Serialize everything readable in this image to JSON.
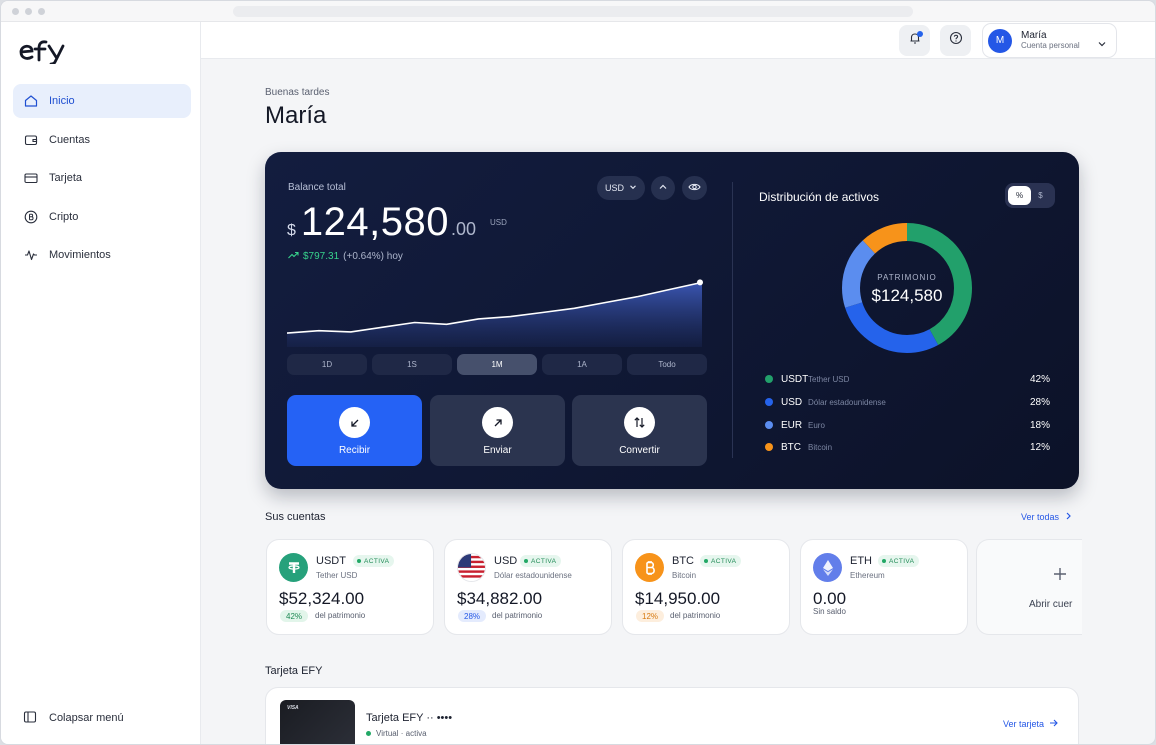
{
  "brand": {
    "logo_text": "efy"
  },
  "sidebar": {
    "items": [
      {
        "label": "Inicio",
        "icon": "home-icon"
      },
      {
        "label": "Cuentas",
        "icon": "wallet-icon"
      },
      {
        "label": "Tarjeta",
        "icon": "credit-card-icon"
      },
      {
        "label": "Cripto",
        "icon": "bitcoin-icon"
      },
      {
        "label": "Movimientos",
        "icon": "activity-icon"
      }
    ],
    "collapse_label": "Colapsar menú"
  },
  "topbar": {
    "user": {
      "initial": "M",
      "name": "María",
      "subtitle": "Cuenta personal"
    }
  },
  "greeting": {
    "line": "Buenas tardes",
    "name": "María"
  },
  "balance": {
    "label": "Balance total",
    "currency_symbol": "$",
    "integer": "124,580",
    "decimals": ".00",
    "unit": "USD",
    "change_amount": "$797.31",
    "change_rest": "(+0.64%) hoy",
    "currency_select": "USD",
    "ranges": [
      "1D",
      "1S",
      "1M",
      "1A",
      "Todo"
    ],
    "active_range": "1M",
    "actions": [
      "Recibir",
      "Enviar",
      "Convertir"
    ]
  },
  "distribution": {
    "title": "Distribución de activos",
    "toggle": [
      "%",
      "$"
    ],
    "center_label": "PATRIMONIO",
    "center_value": "$124,580",
    "assets": [
      {
        "sym": "USDT",
        "desc": "Tether USD",
        "pct": "42%",
        "value": 42,
        "color": "#22a06b"
      },
      {
        "sym": "USD",
        "desc": "Dólar estadounidense",
        "pct": "28%",
        "value": 28,
        "color": "#2563eb"
      },
      {
        "sym": "EUR",
        "desc": "Euro",
        "pct": "18%",
        "value": 18,
        "color": "#5b8def"
      },
      {
        "sym": "BTC",
        "desc": "Bitcoin",
        "pct": "12%",
        "value": 12,
        "color": "#f7931a"
      }
    ]
  },
  "accounts": {
    "title": "Sus cuentas",
    "see_all": "Ver todas",
    "items": [
      {
        "sym": "USDT",
        "badge": "ACTIVA",
        "full": "Tether USD",
        "amount": "$52,324.00",
        "pct": "42%",
        "pct_label": "del patrimonio"
      },
      {
        "sym": "USD",
        "badge": "ACTIVA",
        "full": "Dólar estadounidense",
        "amount": "$34,882.00",
        "pct": "28%",
        "pct_label": "del patrimonio"
      },
      {
        "sym": "BTC",
        "badge": "ACTIVA",
        "full": "Bitcoin",
        "amount": "$14,950.00",
        "pct": "12%",
        "pct_label": "del patrimonio"
      },
      {
        "sym": "ETH",
        "badge": "ACTIVA",
        "full": "Ethereum",
        "amount": "0.00",
        "note": "Sin saldo"
      }
    ],
    "open_label": "Abrir cuer"
  },
  "card": {
    "title": "Tarjeta EFY",
    "name": "Tarjeta EFY ·· ••••",
    "status": "Virtual · activa",
    "link": "Ver tarjeta",
    "brand_mark": "VISA"
  }
}
